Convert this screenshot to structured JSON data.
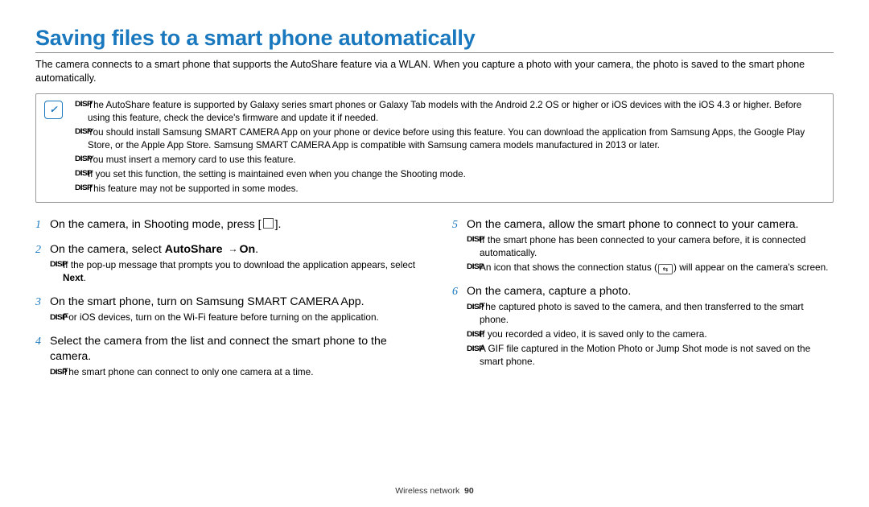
{
  "page": {
    "title": "Saving files to a smart phone automatically",
    "intro": "The camera connects to a smart phone that supports the AutoShare feature via a WLAN. When you capture a photo with your camera, the photo is saved to the smart phone automatically."
  },
  "iconText": "✓",
  "arrowGlyph": "→",
  "menuGlyph": "",
  "statusGlyph": "⇆",
  "noteBullets": [
    "The AutoShare feature is supported by Galaxy series smart phones or Galaxy Tab models with the Android 2.2 OS or higher or iOS devices with the iOS 4.3 or higher. Before using this feature, check the device's firmware and update it if needed.",
    "You should install Samsung SMART CAMERA App on your phone or device before using this feature. You can download the application from Samsung Apps, the Google Play Store, or the Apple App Store. Samsung SMART CAMERA App is compatible with Samsung camera models manufactured in 2013 or later.",
    "You must insert a memory card to use this feature.",
    "If you set this function, the setting is maintained even when you change the Shooting mode.",
    "This feature may not be supported in some modes."
  ],
  "left": {
    "steps": [
      {
        "num": "1",
        "parts": [
          "On the camera, in Shooting mode, press [",
          "MENU",
          "]."
        ]
      },
      {
        "num": "2",
        "parts": [
          "On the camera, select ",
          "AutoShare",
          "ARROW",
          "On",
          "."
        ],
        "sub": [
          {
            "pre": "If the pop-up message that prompts you to download the application appears, select ",
            "bold": "Next",
            "post": "."
          }
        ]
      },
      {
        "num": "3",
        "parts": [
          "On the smart phone, turn on Samsung SMART CAMERA App."
        ],
        "sub": [
          {
            "pre": "For iOS devices, turn on the Wi-Fi feature before turning on the application."
          }
        ]
      },
      {
        "num": "4",
        "parts": [
          "Select the camera from the list and connect the smart phone to the camera."
        ],
        "sub": [
          {
            "pre": "The smart phone can connect to only one camera at a time."
          }
        ]
      }
    ]
  },
  "right": {
    "steps": [
      {
        "num": "5",
        "parts": [
          "On the camera, allow the smart phone to connect to your camera."
        ],
        "sub": [
          {
            "pre": "If the smart phone has been connected to your camera before, it is connected automatically."
          },
          {
            "pre": "An icon that shows the connection status (",
            "status": true,
            "post": ") will appear on the camera's screen."
          }
        ]
      },
      {
        "num": "6",
        "parts": [
          "On the camera, capture a photo."
        ],
        "sub": [
          {
            "pre": "The captured photo is saved to the camera, and then transferred to the smart phone."
          },
          {
            "pre": "If you recorded a video, it is saved only to the camera."
          },
          {
            "pre": "A GIF file captured in the Motion Photo or Jump Shot mode is not saved on the smart phone."
          }
        ]
      }
    ]
  },
  "footer": {
    "section": "Wireless network",
    "page": "90"
  }
}
